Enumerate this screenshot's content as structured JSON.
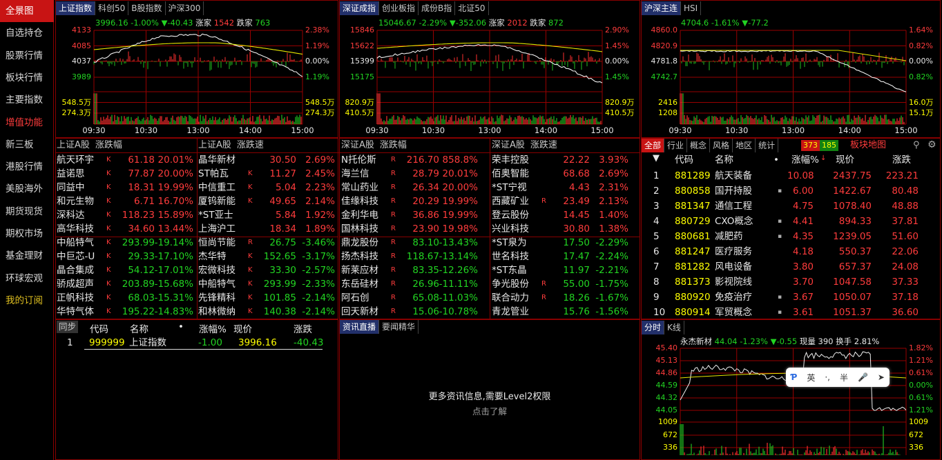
{
  "sidebar": [
    "全景图",
    "自选持仓",
    "股票行情",
    "板块行情",
    "主要指数",
    "增值功能",
    "新三板",
    "港股行情",
    "美股海外",
    "期货现货",
    "期权市场",
    "基金理财",
    "环球宏观",
    "我的订阅"
  ],
  "chart1": {
    "tabs": [
      "上证指数",
      "科创50",
      "B股指数",
      "沪深300"
    ],
    "info_price": "3996.16",
    "info_pct": "-1.00%",
    "info_chg": "▼-40.43",
    "info_up_label": "涨家",
    "info_up": "1542",
    "info_down_label": "跌家",
    "info_down": "763",
    "left_labels": [
      "4133",
      "4085",
      "4037",
      "3989",
      "548.5万",
      "274.3万"
    ],
    "right_labels": [
      "2.38%",
      "1.19%",
      "0.00%",
      "1.19%",
      "548.5万",
      "274.3万"
    ],
    "times": [
      "09:30",
      "10:30",
      "13:00",
      "14:00",
      "15:00"
    ]
  },
  "chart2": {
    "tabs": [
      "深证成指",
      "创业板指",
      "成份B指",
      "北证50"
    ],
    "info_price": "15046.67",
    "info_pct": "-2.29%",
    "info_chg": "▼-352.06",
    "info_up_label": "涨家",
    "info_up": "2012",
    "info_down_label": "跌家",
    "info_down": "872",
    "left_labels": [
      "15846",
      "15622",
      "15399",
      "15175",
      "820.9万",
      "410.5万"
    ],
    "right_labels": [
      "2.90%",
      "1.45%",
      "0.00%",
      "1.45%",
      "820.9万",
      "410.5万"
    ],
    "times": [
      "09:30",
      "10:30",
      "13:00",
      "14:00",
      "15:00"
    ]
  },
  "chart3": {
    "tabs": [
      "沪深主连",
      "HSI"
    ],
    "info_price": "4704.6",
    "info_pct": "-1.61%",
    "info_chg": "▼-77.2",
    "left_labels": [
      "4860.0",
      "4820.9",
      "4781.8",
      "4742.7",
      "2416",
      "1208"
    ],
    "right_labels": [
      "1.64%",
      "0.82%",
      "0.00%",
      "0.82%",
      "16.0万",
      "15.1万"
    ],
    "times": [
      "09:30",
      "10:30",
      "13:00",
      "14:00",
      "15:00"
    ]
  },
  "lists": [
    {
      "market": "上证A股",
      "sort": "涨跌幅",
      "rows": [
        [
          "航天环宇",
          "K",
          "61.18",
          "20.01%"
        ],
        [
          "益诺思",
          "K",
          "77.87",
          "20.00%"
        ],
        [
          "同益中",
          "K",
          "18.31",
          "19.99%"
        ],
        [
          "和元生物",
          "K",
          "6.71",
          "16.70%"
        ],
        [
          "深科达",
          "K",
          "118.23",
          "15.89%"
        ],
        [
          "高华科技",
          "K",
          "34.60",
          "13.44%"
        ],
        [
          "中船特气",
          "K",
          "293.99",
          "-19.14%"
        ],
        [
          "中巨芯-U",
          "K",
          "29.33",
          "-17.10%"
        ],
        [
          "晶合集成",
          "K",
          "54.12",
          "-17.01%"
        ],
        [
          "骄成超声",
          "K",
          "203.89",
          "-15.68%"
        ],
        [
          "正帆科技",
          "K",
          "68.03",
          "-15.31%"
        ],
        [
          "华特气体",
          "K",
          "195.22",
          "-14.83%"
        ]
      ]
    },
    {
      "market": "上证A股",
      "sort": "涨跌速",
      "rows": [
        [
          "晶华新材",
          "",
          "30.50",
          "2.69%"
        ],
        [
          "ST帕瓦",
          "K",
          "11.27",
          "2.45%"
        ],
        [
          "中信重工",
          "K",
          "5.04",
          "2.23%"
        ],
        [
          "厦钨新能",
          "K",
          "49.65",
          "2.14%"
        ],
        [
          "*ST亚士",
          "",
          "5.84",
          "1.92%"
        ],
        [
          "上海沪工",
          "",
          "18.34",
          "1.89%"
        ],
        [
          "恒尚节能",
          "R",
          "26.75",
          "-3.46%"
        ],
        [
          "杰华特",
          "K",
          "152.65",
          "-3.17%"
        ],
        [
          "宏微科技",
          "K",
          "33.30",
          "-2.57%"
        ],
        [
          "中船特气",
          "K",
          "293.99",
          "-2.33%"
        ],
        [
          "先锋精科",
          "K",
          "101.85",
          "-2.14%"
        ],
        [
          "和林微纳",
          "K",
          "140.38",
          "-2.14%"
        ]
      ]
    },
    {
      "market": "深证A股",
      "sort": "涨跌幅",
      "rows": [
        [
          "N托伦斯",
          "R",
          "216.70",
          "858.8%"
        ],
        [
          "海兰信",
          "R",
          "28.79",
          "20.01%"
        ],
        [
          "常山药业",
          "R",
          "26.34",
          "20.00%"
        ],
        [
          "佳缘科技",
          "R",
          "20.29",
          "19.99%"
        ],
        [
          "金利华电",
          "R",
          "36.86",
          "19.99%"
        ],
        [
          "国林科技",
          "R",
          "23.90",
          "19.98%"
        ],
        [
          "鼎龙股份",
          "R",
          "83.10",
          "-13.43%"
        ],
        [
          "扬杰科技",
          "R",
          "118.67",
          "-13.14%"
        ],
        [
          "新莱应材",
          "R",
          "83.35",
          "-12.26%"
        ],
        [
          "东岳硅材",
          "R",
          "26.96",
          "-11.11%"
        ],
        [
          "阿石创",
          "R",
          "65.08",
          "-11.03%"
        ],
        [
          "回天新材",
          "R",
          "15.06",
          "-10.78%"
        ]
      ]
    },
    {
      "market": "深证A股",
      "sort": "涨跌速",
      "rows": [
        [
          "荣丰控股",
          "",
          "22.22",
          "3.93%"
        ],
        [
          "佰奥智能",
          "",
          "68.68",
          "2.69%"
        ],
        [
          "*ST宁视",
          "",
          "4.43",
          "2.31%"
        ],
        [
          "西藏矿业",
          "R",
          "23.49",
          "2.13%"
        ],
        [
          "登云股份",
          "",
          "14.45",
          "1.40%"
        ],
        [
          "兴业科技",
          "",
          "30.80",
          "1.38%"
        ],
        [
          "*ST泉为",
          "",
          "17.50",
          "-2.29%"
        ],
        [
          "世名科技",
          "",
          "17.47",
          "-2.24%"
        ],
        [
          "*ST东晶",
          "",
          "11.97",
          "-2.21%"
        ],
        [
          "争光股份",
          "R",
          "55.00",
          "-1.75%"
        ],
        [
          "联合动力",
          "R",
          "18.26",
          "-1.67%"
        ],
        [
          "青龙管业",
          "",
          "15.76",
          "-1.56%"
        ]
      ]
    }
  ],
  "board": {
    "tabs": [
      "全部",
      "行业",
      "概念",
      "风格",
      "地区",
      "统计"
    ],
    "up_count": "373",
    "down_count": "185",
    "map_link": "板块地图",
    "headers": [
      "代码",
      "名称",
      "•",
      "涨幅%",
      "现价",
      "涨跌"
    ],
    "rows": [
      [
        "1",
        "881289",
        "航天装备",
        "",
        "10.08",
        "2437.75",
        "223.21"
      ],
      [
        "2",
        "880858",
        "国开持股",
        "▪",
        "6.00",
        "1422.67",
        "80.48"
      ],
      [
        "3",
        "881347",
        "通信工程",
        "",
        "4.75",
        "1078.40",
        "48.88"
      ],
      [
        "4",
        "880729",
        "CXO概念",
        "▪",
        "4.41",
        "894.33",
        "37.81"
      ],
      [
        "5",
        "880681",
        "减肥药",
        "▪",
        "4.35",
        "1239.05",
        "51.60"
      ],
      [
        "6",
        "881247",
        "医疗服务",
        "",
        "4.18",
        "550.37",
        "22.06"
      ],
      [
        "7",
        "881282",
        "风电设备",
        "",
        "3.80",
        "657.37",
        "24.08"
      ],
      [
        "8",
        "881373",
        "影视院线",
        "",
        "3.70",
        "1047.58",
        "37.33"
      ],
      [
        "9",
        "880920",
        "免疫治疗",
        "▪",
        "3.67",
        "1050.07",
        "37.18"
      ],
      [
        "10",
        "880914",
        "军贸概念",
        "▪",
        "3.61",
        "1051.37",
        "36.60"
      ]
    ]
  },
  "sync": {
    "tab": "同步",
    "headers": [
      "代码",
      "名称",
      "•",
      "涨幅%",
      "现价",
      "涨跌"
    ],
    "row": [
      "1",
      "999999",
      "上证指数",
      "-1.00",
      "3996.16",
      "-40.43"
    ]
  },
  "news": {
    "tabs": [
      "资讯直播",
      "要闻精华"
    ],
    "message": "更多资讯信息,需要Level2权限",
    "link": "点击了解"
  },
  "stock": {
    "tabs": [
      "分时",
      "K线"
    ],
    "name": "永杰新材",
    "price": "44.04",
    "pct": "-1.23%",
    "chg": "▼-0.55",
    "vol_label": "现量",
    "vol": "390",
    "turn_label": "换手",
    "turn": "2.81%",
    "left_labels": [
      "45.40",
      "45.13",
      "44.86",
      "44.59",
      "44.32",
      "44.05",
      "1009",
      "672",
      "336"
    ],
    "right_labels": [
      "1.82%",
      "1.21%",
      "0.61%",
      "0.00%",
      "0.61%",
      "1.21%",
      "1009",
      "672",
      "336"
    ]
  },
  "ime": [
    "英",
    "·,",
    "半"
  ]
}
